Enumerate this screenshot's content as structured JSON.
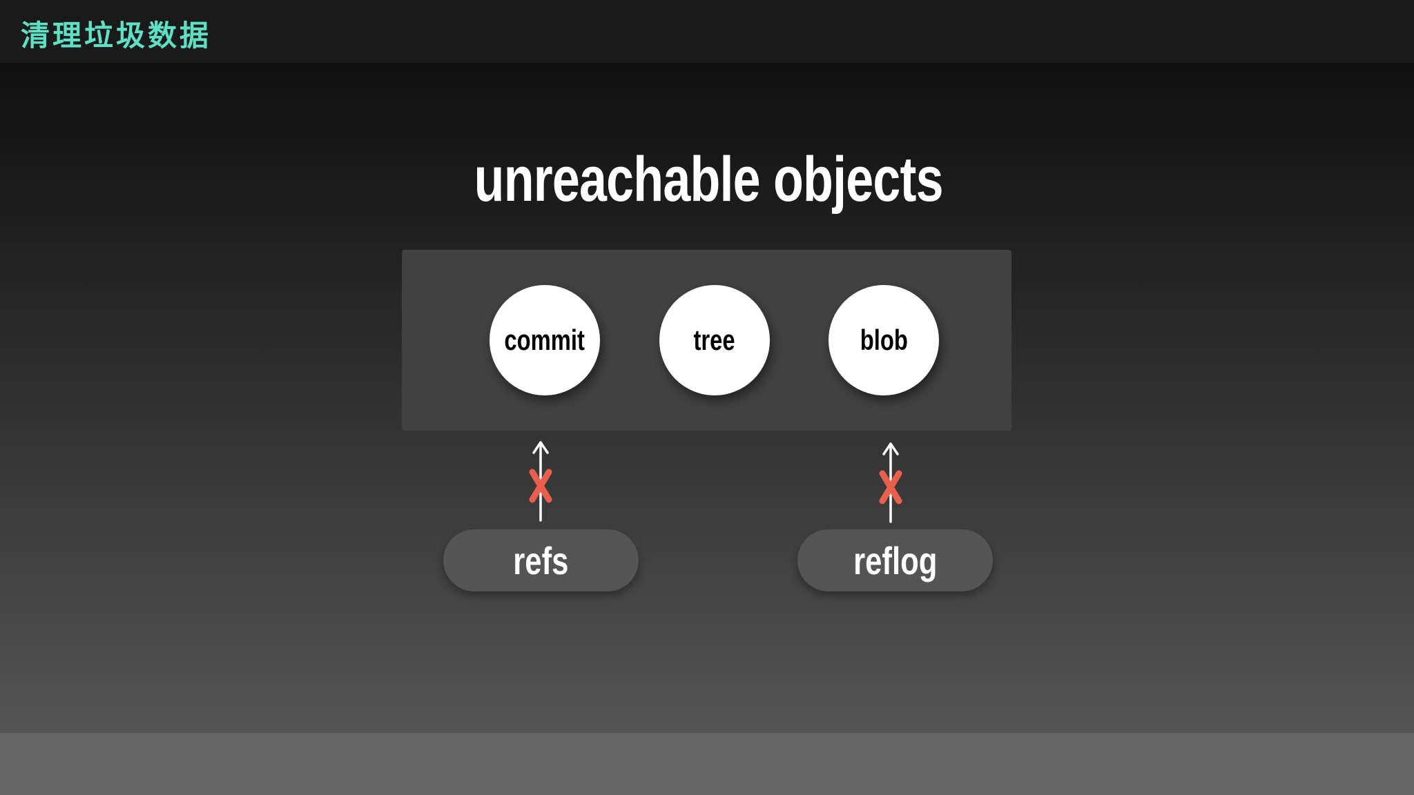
{
  "header": {
    "section_title": "清理垃圾数据"
  },
  "slide": {
    "title": "unreachable objects"
  },
  "objects": [
    {
      "label": "commit"
    },
    {
      "label": "tree"
    },
    {
      "label": "blob"
    }
  ],
  "refs": [
    {
      "label": "refs"
    },
    {
      "label": "reflog"
    }
  ],
  "colors": {
    "accent": "#5fe0c4",
    "cross": "#e8604c",
    "node_fill": "#ffffff",
    "box_fill": "#414141",
    "pill_fill": "#555555"
  }
}
